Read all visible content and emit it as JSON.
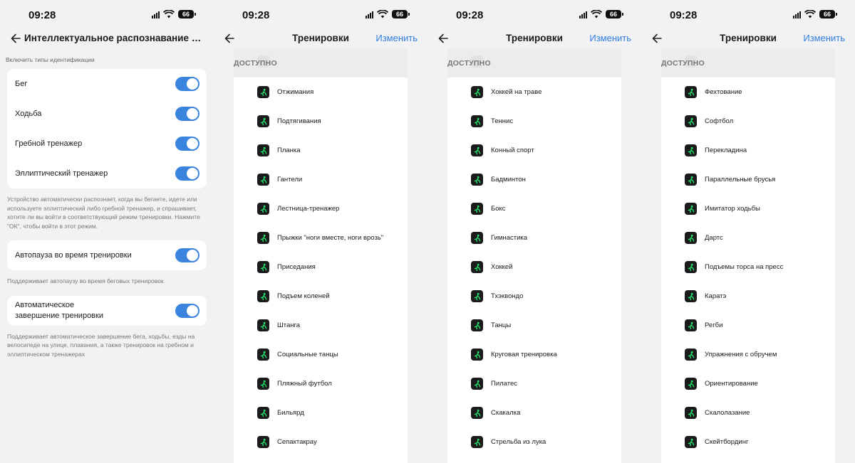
{
  "status_bar": {
    "time": "09:28",
    "battery": "66"
  },
  "screen1": {
    "title": "Интеллектуальное распознавание тренировок",
    "section_caption": "Включить типы идентификации",
    "toggles": [
      {
        "label": "Бег",
        "on": true
      },
      {
        "label": "Ходьба",
        "on": true
      },
      {
        "label": "Гребной тренажер",
        "on": true
      },
      {
        "label": "Эллиптический тренажер",
        "on": true
      }
    ],
    "toggles_description": "Устройство автоматически распознает, когда вы бегаете, идете или используете эллиптический либо гребной тренажер, и спрашивает, хотите ли вы войти в соответствующий режим тренировки. Нажмите \"ОК\", чтобы войти в этот режим.",
    "autopause": {
      "label": "Автопауза во время тренировки",
      "on": true
    },
    "autopause_description": "Поддерживает автопаузу во время беговых тренировок",
    "autofinish": {
      "label": "Автоматическое завершение тренировки",
      "on": true
    },
    "autofinish_description": "Поддерживает автоматическое завершение бега, ходьбы, езды на велосипеде на улице, плавания, а также тренировок на гребном и эллиптическом тренажерах"
  },
  "workouts": {
    "title": "Тренировки",
    "edit_label": "Изменить",
    "available_header": "ДОСТУПНО",
    "icon_color": "#22e06b",
    "screen2": {
      "items": [
        "Отжимания",
        "Подтягивания",
        "Планка",
        "Гантели",
        "Лестница-тренажер",
        "Прыжки \"ноги вместе, ноги врозь\"",
        "Приседания",
        "Подъем коленей",
        "Штанга",
        "Социальные танцы",
        "Пляжный футбол",
        "Бильярд",
        "Сепактакрау"
      ]
    },
    "screen3": {
      "items": [
        "Хоккей на траве",
        "Теннис",
        "Конный спорт",
        "Бадминтон",
        "Бокс",
        "Гимнастика",
        "Хоккей",
        "Тхэквондо",
        "Танцы",
        "Круговая тренировка",
        "Пилатес",
        "Скакалка",
        "Стрельба из лука"
      ]
    },
    "screen4": {
      "items": [
        "Фехтование",
        "Софтбол",
        "Перекладина",
        "Параллельные брусья",
        "Имитатор ходьбы",
        "Дартс",
        "Подъемы торса на пресс",
        "Каратэ",
        "Регби",
        "Упражнения с обручем",
        "Ориентирование",
        "Скалолазание",
        "Скейтбординг"
      ]
    }
  }
}
